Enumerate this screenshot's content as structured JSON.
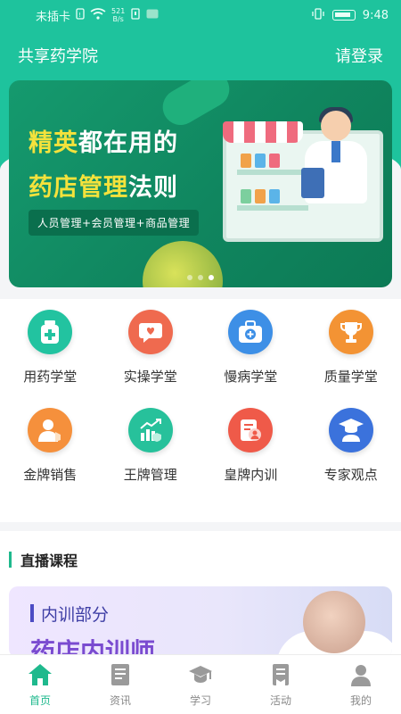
{
  "statusbar": {
    "carrier": "未插卡",
    "net_speed_value": "521",
    "net_speed_unit": "B/s",
    "time": "9:48"
  },
  "header": {
    "title": "共享药学院",
    "login": "请登录"
  },
  "banner": {
    "headline_highlight": "精英",
    "headline_line1_rest": "都在用的",
    "headline_line2_a": "药店管理",
    "headline_line2_b": "法则",
    "tagline": "人员管理+会员管理+商品管理",
    "slide_count": 3,
    "active_slide": 3
  },
  "grid": {
    "items": [
      {
        "label": "用药学堂",
        "icon": "medicine-bottle-icon",
        "color": "#22c3a0"
      },
      {
        "label": "实操学堂",
        "icon": "heart-chat-icon",
        "color": "#ef6a4f"
      },
      {
        "label": "慢病学堂",
        "icon": "medical-kit-icon",
        "color": "#3d8fe6"
      },
      {
        "label": "质量学堂",
        "icon": "trophy-icon",
        "color": "#f39334"
      },
      {
        "label": "金牌销售",
        "icon": "person-badge-icon",
        "color": "#f5903c"
      },
      {
        "label": "王牌管理",
        "icon": "growth-chart-icon",
        "color": "#27c19b"
      },
      {
        "label": "皇牌内训",
        "icon": "document-person-icon",
        "color": "#ef5a49"
      },
      {
        "label": "专家观点",
        "icon": "graduate-icon",
        "color": "#3b72dc"
      }
    ]
  },
  "live": {
    "title": "直播课程",
    "card_tag": "内训部分",
    "card_big": "药店内训师"
  },
  "tabbar": {
    "tabs": [
      {
        "label": "首页",
        "icon": "home-icon",
        "active": true
      },
      {
        "label": "资讯",
        "icon": "news-icon",
        "active": false
      },
      {
        "label": "学习",
        "icon": "graduation-cap-icon",
        "active": false
      },
      {
        "label": "活动",
        "icon": "flag-icon",
        "active": false
      },
      {
        "label": "我的",
        "icon": "user-icon",
        "active": false
      }
    ],
    "active_color": "#1fb98d",
    "inactive_color": "#9a9a9a"
  }
}
